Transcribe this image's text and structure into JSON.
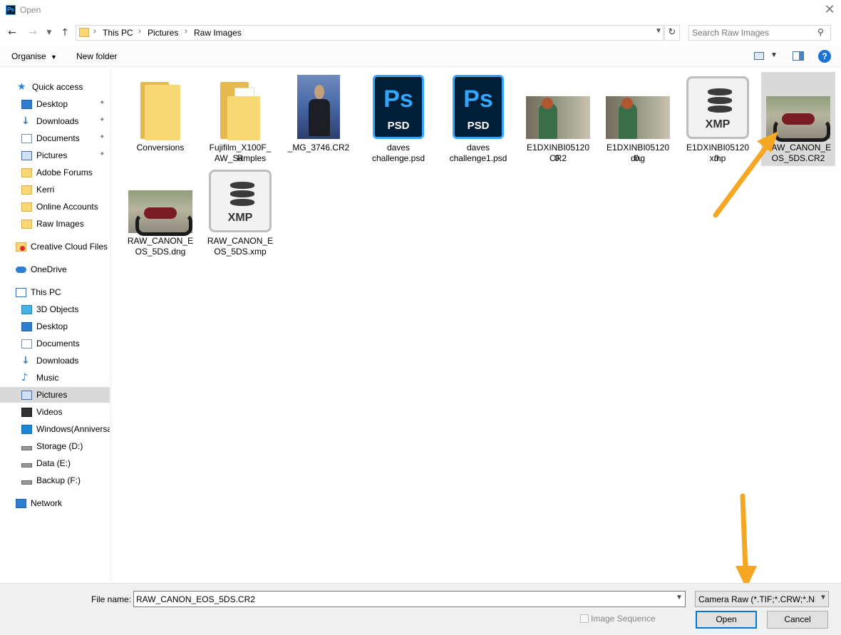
{
  "window": {
    "title": "Open",
    "app_icon_text": "Ps"
  },
  "address_bar": {
    "crumbs": [
      "This PC",
      "Pictures",
      "Raw Images"
    ]
  },
  "search": {
    "placeholder": "Search Raw Images"
  },
  "toolbar": {
    "organise_label": "Organise",
    "new_folder_label": "New folder"
  },
  "sidebar": {
    "items": [
      {
        "label": "Quick access",
        "icon": "star-icon"
      },
      {
        "label": "Desktop",
        "icon": "desktop-icon",
        "pinned": true
      },
      {
        "label": "Downloads",
        "icon": "download-icon",
        "pinned": true
      },
      {
        "label": "Documents",
        "icon": "documents-icon",
        "pinned": true
      },
      {
        "label": "Pictures",
        "icon": "pictures-icon",
        "pinned": true
      },
      {
        "label": "Adobe Forums",
        "icon": "folder-icon"
      },
      {
        "label": "Kerri",
        "icon": "folder-icon"
      },
      {
        "label": "Online Accounts",
        "icon": "folder-icon"
      },
      {
        "label": "Raw Images",
        "icon": "folder-icon"
      },
      {
        "label": "Creative Cloud Files",
        "icon": "creative-cloud-icon"
      },
      {
        "label": "OneDrive",
        "icon": "cloud-icon"
      },
      {
        "label": "This PC",
        "icon": "computer-icon"
      },
      {
        "label": "3D Objects",
        "icon": "cube-icon"
      },
      {
        "label": "Desktop",
        "icon": "desktop-icon"
      },
      {
        "label": "Documents",
        "icon": "documents-icon"
      },
      {
        "label": "Downloads",
        "icon": "download-icon"
      },
      {
        "label": "Music",
        "icon": "music-icon"
      },
      {
        "label": "Pictures",
        "icon": "pictures-icon",
        "selected": true
      },
      {
        "label": "Videos",
        "icon": "film-icon"
      },
      {
        "label": "Windows(Anniversa",
        "icon": "windows-drive-icon"
      },
      {
        "label": "Storage (D:)",
        "icon": "drive-icon"
      },
      {
        "label": "Data (E:)",
        "icon": "drive-icon"
      },
      {
        "label": "Backup (F:)",
        "icon": "drive-icon"
      },
      {
        "label": "Network",
        "icon": "network-icon"
      }
    ]
  },
  "files": [
    {
      "name": "Conversions",
      "kind": "folder"
    },
    {
      "name": "Fujifilm_X100F_RAW_Samples",
      "kind": "folder-docs"
    },
    {
      "name": "_MG_3746.CR2",
      "kind": "portrait-photo"
    },
    {
      "name": "daves challenge.psd",
      "kind": "psd"
    },
    {
      "name": "daves challenge1.psd",
      "kind": "psd"
    },
    {
      "name": "E1DXINBI051200.CR2",
      "kind": "green-photo"
    },
    {
      "name": "E1DXINBI051200.dng",
      "kind": "green-photo"
    },
    {
      "name": "E1DXINBI051200.xmp",
      "kind": "xmp"
    },
    {
      "name": "RAW_CANON_EOS_5DS.CR2",
      "kind": "moto-photo",
      "selected": true
    },
    {
      "name": "RAW_CANON_EOS_5DS.dng",
      "kind": "moto-photo"
    },
    {
      "name": "RAW_CANON_EOS_5DS.xmp",
      "kind": "xmp"
    }
  ],
  "icon_text": {
    "ps": "Ps",
    "psd": "PSD",
    "xmp": "XMP"
  },
  "captions": {
    "f0": [
      "Conversions"
    ],
    "f1": [
      "Fujifilm_X100F_R",
      "AW_Samples"
    ],
    "f2": [
      "_MG_3746.CR2"
    ],
    "f3": [
      "daves",
      "challenge.psd"
    ],
    "f4": [
      "daves",
      "challenge1.psd"
    ],
    "f5": [
      "E1DXINBI051200.",
      "CR2"
    ],
    "f6": [
      "E1DXINBI051200.",
      "dng"
    ],
    "f7": [
      "E1DXINBI051200.",
      "xmp"
    ],
    "f8": [
      "RAW_CANON_E",
      "OS_5DS.CR2"
    ],
    "f9": [
      "RAW_CANON_E",
      "OS_5DS.dng"
    ],
    "f10": [
      "RAW_CANON_E",
      "OS_5DS.xmp"
    ]
  },
  "footer": {
    "file_name_label": "File name:",
    "file_name_value": "RAW_CANON_EOS_5DS.CR2",
    "file_type_value": "Camera Raw (*.TIF;*.CRW;*.NEF",
    "image_sequence_label": "Image Sequence",
    "open_label": "Open",
    "cancel_label": "Cancel"
  },
  "colors": {
    "annotation_arrow": "#f5a623",
    "selection": "#d9d9d9",
    "ps_blue": "#31a8ff",
    "ps_dark": "#001e36"
  }
}
